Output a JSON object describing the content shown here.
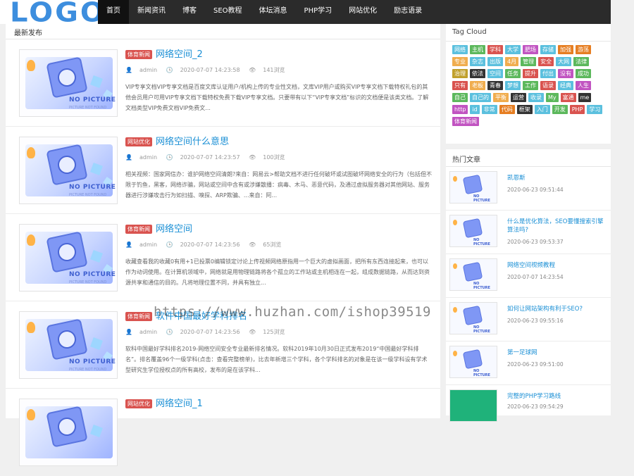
{
  "logo": {
    "text": "LOGO"
  },
  "nav": {
    "items": [
      "首页",
      "新闻资讯",
      "博客",
      "SEO教程",
      "体坛消息",
      "PHP学习",
      "网站优化",
      "励志语录"
    ]
  },
  "main": {
    "title": "最新发布",
    "posts": [
      {
        "tag": "体育新闻",
        "title": "网络空间_2",
        "author": "admin",
        "date": "2020-07-07 14:23:58",
        "views": "141浏览",
        "excerpt": "VIP专享文档VIP专享文档是百度文库认证用户/机构上传的专业性文档，文库VIP用户或购买VIP专享文档下载特权礼包的其他会员用户可用VIP专享文档下载特权免费下载VIP专享文档。只要带有以下“VIP专享文档”标识的文档便是该类文档。了解文档类型VIP免费文档VIP免费文..."
      },
      {
        "tag": "网站优化",
        "title": "网络空间什么意思",
        "author": "admin",
        "date": "2020-07-07 14:23:57",
        "views": "100浏览",
        "excerpt": "相关视频：国家网信办：谁护网络空间清朗?来自：网易云>帮助文档不进行任何破坏或试图破坏网络安全的行为（包括但不限于钓鱼，黑客，网络诈骗，网站或空间中含有或涉嫌散播：病毒、木马、恶意代码，及通过虚拟服务器对其他网站、服务器进行涉嫌攻击行为如扫描、嗅探、ARP欺骗、...来自：阿..."
      },
      {
        "tag": "体育新闻",
        "title": "网络空间",
        "author": "admin",
        "date": "2020-07-07 14:23:56",
        "views": "65浏览",
        "excerpt": "收藏查看我的收藏0有用+1已投票0编辑锁定讨论上传视频网络原指用一个巨大的虚拟画面，把所有东西连接起来，也可以作为动词使用。在计算机领域中，网络就是用物理链路将各个孤立的工作站或主机相连在一起，组成数据链路，从而达到资源共享和通信的目的。凡将地理位置不同，并具有独立..."
      },
      {
        "tag": "体育新闻",
        "title": "软件中国最好学科排名",
        "author": "admin",
        "date": "2020-07-07 14:23:56",
        "views": "125浏览",
        "excerpt": "软科中国最好学科排名2019-网络空间安全专业最新排名情况。软科2019年10月30日正式发布2019“中国最好学科排名”。排名覆盖96个一级学科(点击：查看完整榜单)，比去年新增三个学科，各个学科排名的对象是在该一级学科设有学术型研究生学位授权点的所有高校，发布的是在该学科..."
      },
      {
        "tag": "网站优化",
        "title": "网络空间_1"
      }
    ]
  },
  "tagcloud": {
    "title": "Tag Cloud",
    "tags": [
      {
        "label": "网络",
        "color": "#5bc0de"
      },
      {
        "label": "主机",
        "color": "#5cb85c"
      },
      {
        "label": "学科",
        "color": "#d9534f"
      },
      {
        "label": "大学",
        "color": "#5bc0de"
      },
      {
        "label": "肥场",
        "color": "#c154c1"
      },
      {
        "label": "存储",
        "color": "#5bc0de"
      },
      {
        "label": "加强",
        "color": "#e67e22"
      },
      {
        "label": "游荡",
        "color": "#e67e22"
      },
      {
        "label": "专业",
        "color": "#f0ad4e"
      },
      {
        "label": "杂志",
        "color": "#5bc0de"
      },
      {
        "label": "出版",
        "color": "#5bc0de"
      },
      {
        "label": "4月",
        "color": "#f0ad4e"
      },
      {
        "label": "管理",
        "color": "#5cb85c"
      },
      {
        "label": "安全",
        "color": "#d9534f"
      },
      {
        "label": "大网",
        "color": "#5bc0de"
      },
      {
        "label": "法律",
        "color": "#5cb85c"
      },
      {
        "label": "治理",
        "color": "#c0a02b"
      },
      {
        "label": "依法",
        "color": "#333333"
      },
      {
        "label": "空间",
        "color": "#5bc0de"
      },
      {
        "label": "任务",
        "color": "#5cb85c"
      },
      {
        "label": "提升",
        "color": "#d9534f"
      },
      {
        "label": "付出",
        "color": "#5bc0de"
      },
      {
        "label": "没有",
        "color": "#c154c1"
      },
      {
        "label": "成功",
        "color": "#5cb85c"
      },
      {
        "label": "只有",
        "color": "#d9534f"
      },
      {
        "label": "老板",
        "color": "#f0ad4e"
      },
      {
        "label": "青春",
        "color": "#333333"
      },
      {
        "label": "梦想",
        "color": "#5bc0de"
      },
      {
        "label": "工作",
        "color": "#5cb85c"
      },
      {
        "label": "语录",
        "color": "#d9534f"
      },
      {
        "label": "经典",
        "color": "#5bc0de"
      },
      {
        "label": "人生",
        "color": "#c154c1"
      },
      {
        "label": "自己",
        "color": "#5cb85c"
      },
      {
        "label": "自己的",
        "color": "#5bc0de"
      },
      {
        "label": "平衡",
        "color": "#f0ad4e"
      },
      {
        "label": "运营",
        "color": "#333333"
      },
      {
        "label": "收录",
        "color": "#5bc0de"
      },
      {
        "label": "My",
        "color": "#5cb85c"
      },
      {
        "label": "富通",
        "color": "#d9534f"
      },
      {
        "label": "me",
        "color": "#333333"
      },
      {
        "label": "http",
        "color": "#c154c1"
      },
      {
        "label": "id",
        "color": "#5bc0de"
      },
      {
        "label": "非常",
        "color": "#5bc0de"
      },
      {
        "label": "代码",
        "color": "#e67e22"
      },
      {
        "label": "框架",
        "color": "#333333"
      },
      {
        "label": "入门",
        "color": "#5bc0de"
      },
      {
        "label": "开发",
        "color": "#5cb85c"
      },
      {
        "label": "PHP",
        "color": "#d9534f"
      },
      {
        "label": "学习",
        "color": "#5bc0de"
      },
      {
        "label": "体育新闻",
        "color": "#c154c1"
      }
    ]
  },
  "hot": {
    "title": "热门文章",
    "items": [
      {
        "title": "凯恩斯",
        "date": "2020-06-23 09:51:44"
      },
      {
        "title": "什么是优化算法，SEO要懂搜索引擎算法吗?",
        "date": "2020-06-23 09:53:37"
      },
      {
        "title": "网络空间视频教程",
        "date": "2020-07-07 14:23:54"
      },
      {
        "title": "如何让网站架构有利于SEO?",
        "date": "2020-06-23 09:55:16"
      },
      {
        "title": "第一足球网",
        "date": "2020-06-23 09:51:00"
      },
      {
        "title": "完整的PHP学习路线",
        "date": "2020-06-23 09:54:29"
      }
    ]
  },
  "watermark": "https://www.huzhan.com/ishop39519"
}
